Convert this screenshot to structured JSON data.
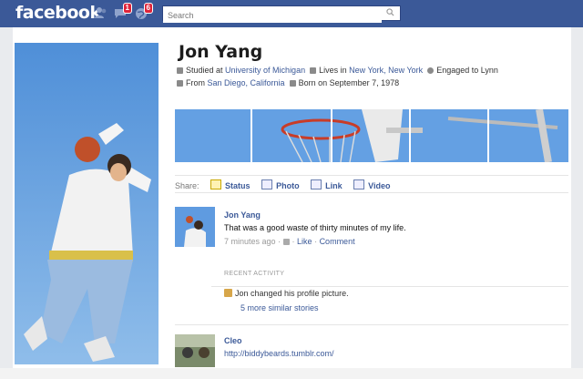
{
  "topbar": {
    "logo": "facebook",
    "badges": {
      "messages": "1",
      "notifications": "6"
    },
    "search_placeholder": "Search"
  },
  "profile": {
    "name": "Jon Yang",
    "info_line1": {
      "studied_prefix": "Studied at",
      "school": "University of Michigan",
      "lives_prefix": "Lives in",
      "city": "New York, New York",
      "engaged": "Engaged to Lynn"
    },
    "info_line2": {
      "from_prefix": "From",
      "hometown": "San Diego, California",
      "born": "Born on September 7, 1978"
    }
  },
  "share": {
    "label": "Share:",
    "options": [
      "Status",
      "Photo",
      "Link",
      "Video"
    ]
  },
  "post": {
    "author": "Jon Yang",
    "text": "That was a good waste of thirty minutes of my life.",
    "time": "7 minutes ago",
    "like": "Like",
    "comment": "Comment"
  },
  "recent_activity": {
    "title": "RECENT ACTIVITY",
    "item": "Jon changed his profile picture.",
    "more": "5 more similar stories"
  },
  "post2": {
    "author": "Cleo",
    "link": "http://biddybeards.tumblr.com/"
  }
}
